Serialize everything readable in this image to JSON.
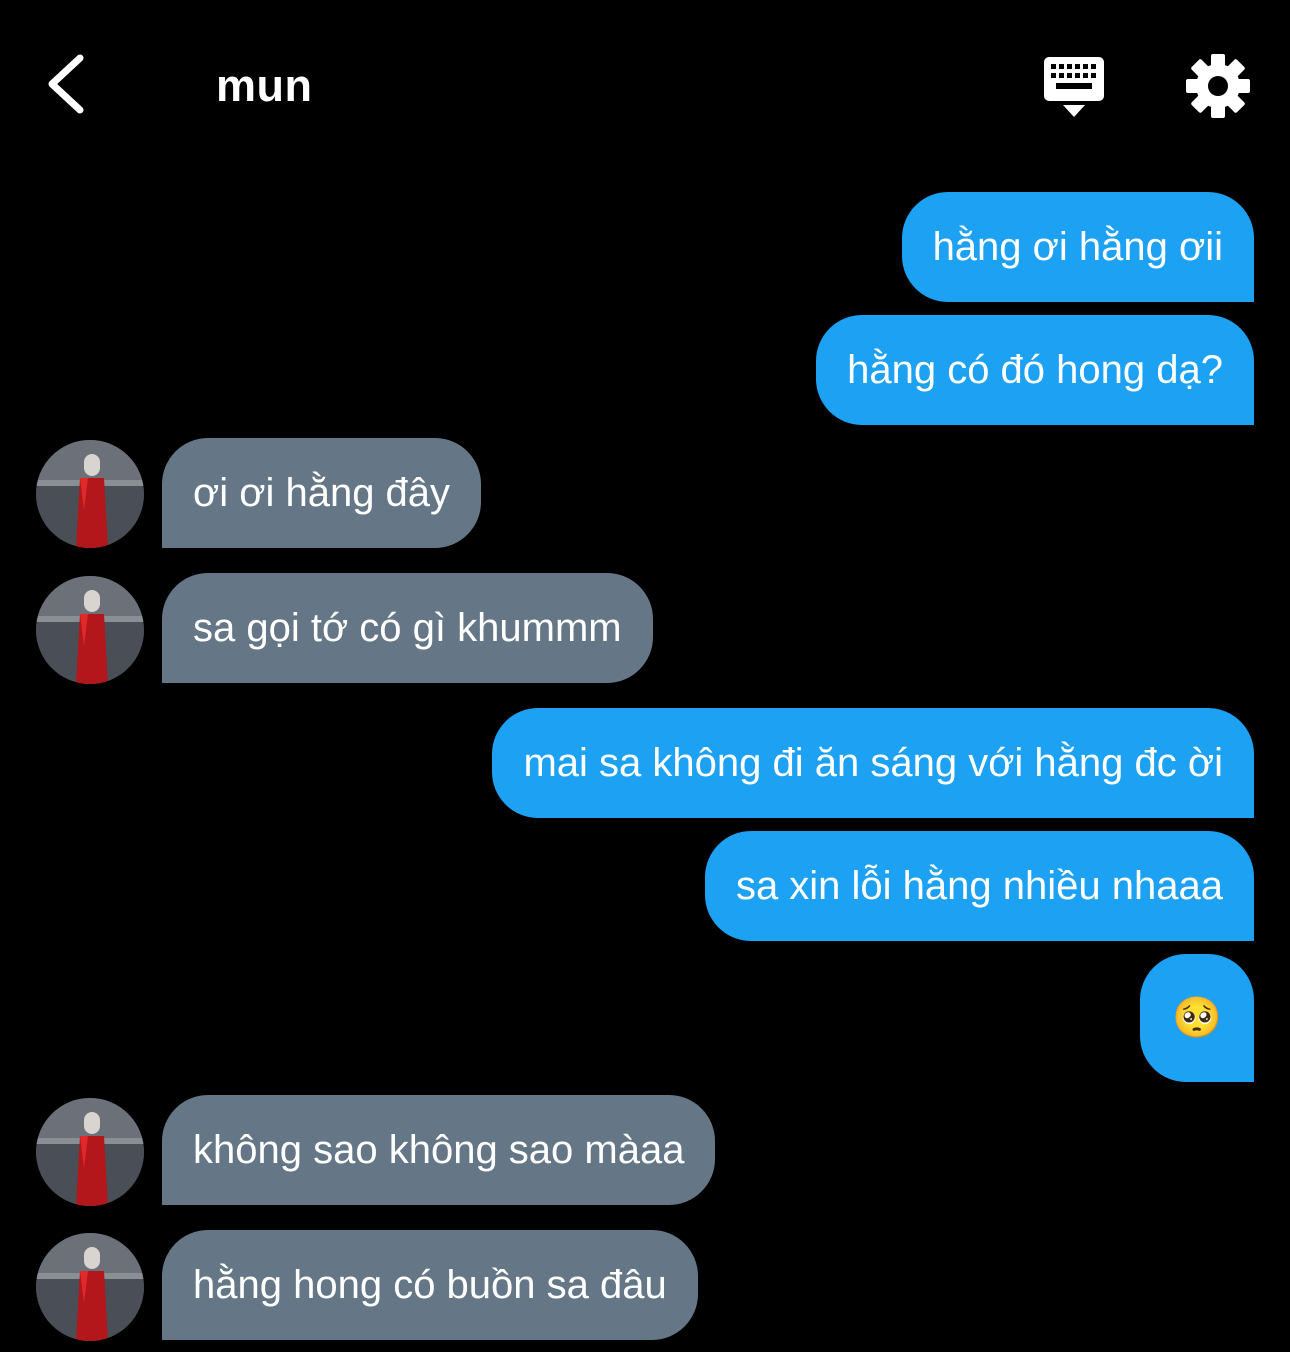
{
  "header": {
    "title": "mun",
    "back_icon": "chevron-left-icon",
    "keyboard_icon": "keyboard-icon",
    "settings_icon": "gear-icon"
  },
  "colors": {
    "background": "#000000",
    "outgoing_bubble": "#1da1f2",
    "incoming_bubble": "#657786",
    "text": "#ffffff"
  },
  "messages": [
    {
      "from": "me",
      "text": "hằng ơi hằng ơii"
    },
    {
      "from": "me",
      "text": "hằng có đó hong dạ?"
    },
    {
      "from": "them",
      "text": "ơi ơi hằng đây"
    },
    {
      "from": "them",
      "text": "sa gọi tớ có gì khummm"
    },
    {
      "from": "me",
      "text": "mai sa không đi ăn sáng với hằng đc ời"
    },
    {
      "from": "me",
      "text": "sa xin lỗi hằng nhiều nhaaa"
    },
    {
      "from": "me",
      "text": "🥺"
    },
    {
      "from": "them",
      "text": "không sao không sao màaa"
    },
    {
      "from": "them",
      "text": "hằng hong có buồn sa đâu"
    }
  ]
}
